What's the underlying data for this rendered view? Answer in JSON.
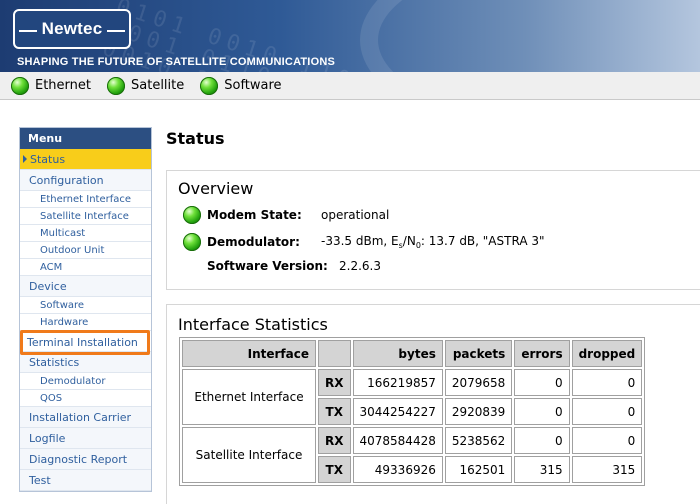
{
  "header": {
    "logo_text": "Newtec",
    "tagline": "SHAPING THE FUTURE OF SATELLITE COMMUNICATIONS"
  },
  "topnav": {
    "items": [
      {
        "label": "Ethernet",
        "status": "green"
      },
      {
        "label": "Satellite",
        "status": "green"
      },
      {
        "label": "Software",
        "status": "green"
      }
    ]
  },
  "menu": {
    "title": "Menu",
    "items": [
      {
        "label": "Status",
        "level": 0,
        "active": true
      },
      {
        "label": "Configuration",
        "level": 0
      },
      {
        "label": "Ethernet Interface",
        "level": 1
      },
      {
        "label": "Satellite Interface",
        "level": 1
      },
      {
        "label": "Multicast",
        "level": 1
      },
      {
        "label": "Outdoor Unit",
        "level": 1
      },
      {
        "label": "ACM",
        "level": 1
      },
      {
        "label": "Device",
        "level": 0
      },
      {
        "label": "Software",
        "level": 1
      },
      {
        "label": "Hardware",
        "level": 1
      },
      {
        "label": "Terminal Installation",
        "level": 0,
        "highlighted": true
      },
      {
        "label": "Statistics",
        "level": 0
      },
      {
        "label": "Demodulator",
        "level": 1
      },
      {
        "label": "QOS",
        "level": 1
      },
      {
        "label": "Installation Carrier",
        "level": 0
      },
      {
        "label": "Logfile",
        "level": 0
      },
      {
        "label": "Diagnostic Report",
        "level": 0
      },
      {
        "label": "Test",
        "level": 0
      }
    ]
  },
  "page": {
    "title": "Status"
  },
  "overview": {
    "title": "Overview",
    "modem_state_label": "Modem State:",
    "modem_state_value": "operational",
    "demodulator_label": "Demodulator:",
    "demodulator_value_prefix": "-33.5 dBm, E",
    "demodulator_value_sub_s": "s",
    "demodulator_value_mid": "/N",
    "demodulator_value_sub_0": "0",
    "demodulator_value_suffix": ": 13.7 dB, \"ASTRA 3\"",
    "software_version_label": "Software Version:",
    "software_version_value": "2.2.6.3"
  },
  "interface_stats": {
    "title": "Interface Statistics",
    "headers": [
      "Interface",
      "",
      "bytes",
      "packets",
      "errors",
      "dropped"
    ],
    "rows": [
      {
        "interface": "Ethernet Interface",
        "rx": {
          "dir": "RX",
          "bytes": "166219857",
          "packets": "2079658",
          "errors": "0",
          "dropped": "0"
        },
        "tx": {
          "dir": "TX",
          "bytes": "3044254227",
          "packets": "2920839",
          "errors": "0",
          "dropped": "0"
        }
      },
      {
        "interface": "Satellite Interface",
        "rx": {
          "dir": "RX",
          "bytes": "4078584428",
          "packets": "5238562",
          "errors": "0",
          "dropped": "0"
        },
        "tx": {
          "dir": "TX",
          "bytes": "49336926",
          "packets": "162501",
          "errors": "315",
          "dropped": "315"
        }
      }
    ]
  },
  "colors": {
    "header_blue": "#2f5a96",
    "menu_head": "#2c4f82",
    "menu_link": "#2f5f9e",
    "active_item": "#f8cd1a",
    "highlight_box": "#f07a1a",
    "status_led": "#22a10d"
  }
}
